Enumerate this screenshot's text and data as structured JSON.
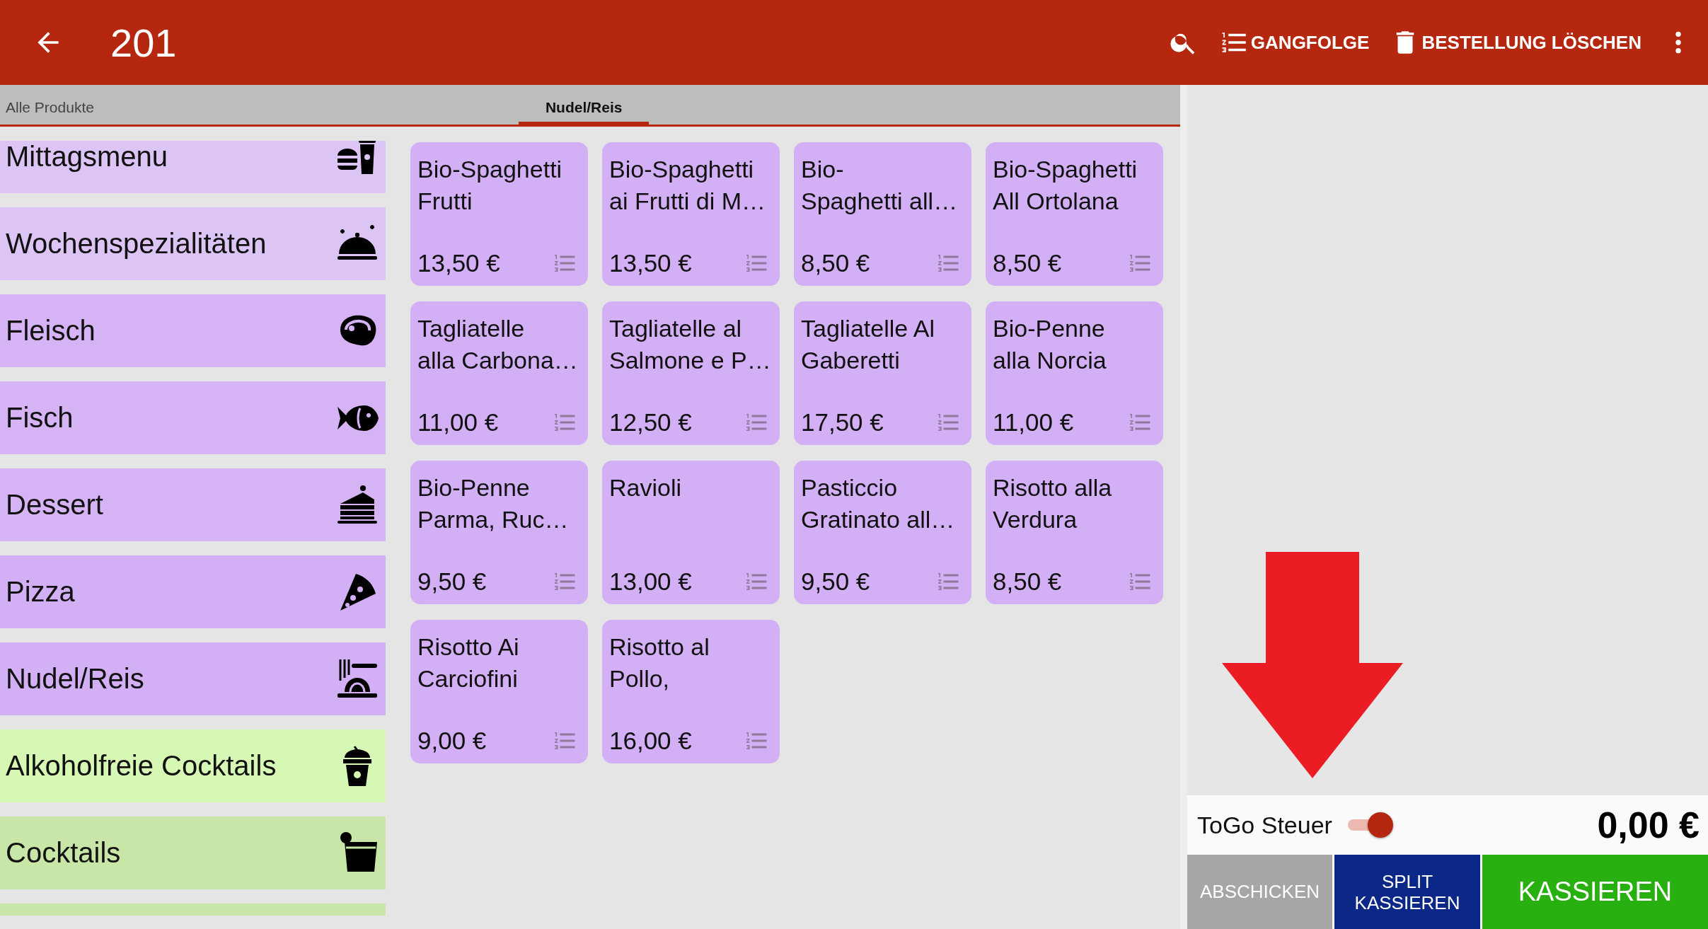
{
  "header": {
    "title": "201",
    "actions": [
      {
        "kind": "search"
      },
      {
        "kind": "order",
        "label": "GANGFOLGE"
      },
      {
        "kind": "delete",
        "label": "BESTELLUNG LÖSCHEN"
      },
      {
        "kind": "more"
      }
    ]
  },
  "tabs": [
    {
      "label": "Alle Produkte",
      "selected": false
    },
    {
      "label": "Nudel/Reis",
      "selected": true
    }
  ],
  "categories": [
    {
      "label": "Mittagsmenu",
      "color": "#dcc4f5"
    },
    {
      "label": "Wochenspezialitäten",
      "color": "#dcc4f5"
    },
    {
      "label": "Fleisch",
      "color": "#d5b3f5"
    },
    {
      "label": "Fisch",
      "color": "#d5b3f5"
    },
    {
      "label": "Dessert",
      "color": "#d5b3f5"
    },
    {
      "label": "Pizza",
      "color": "#d3b0f5"
    },
    {
      "label": "Nudel/Reis",
      "color": "#d3b0f5"
    },
    {
      "label": "Alkoholfreie Cocktails",
      "color": "#d6f8b4"
    },
    {
      "label": "Cocktails",
      "color": "#c8e6a8"
    },
    {
      "color": "#c8e6a8"
    }
  ],
  "products": [
    {
      "name": "Bio-Spaghetti\nFrutti",
      "price": "13,50 €"
    },
    {
      "name": "Bio-Spaghetti\nai Frutti di M…",
      "price": "13,50 €"
    },
    {
      "name": "Bio-\nSpaghetti all…",
      "price": "8,50 €"
    },
    {
      "name": "Bio-Spaghetti\nAll Ortolana",
      "price": "8,50 €"
    },
    {
      "name": "Tagliatelle\nalla Carbona…",
      "price": "11,00 €"
    },
    {
      "name": "Tagliatelle al\nSalmone e P…",
      "price": "12,50 €"
    },
    {
      "name": "Tagliatelle Al\nGaberetti",
      "price": "17,50 €"
    },
    {
      "name": "Bio-Penne\nalla Norcia",
      "price": "11,00 €"
    },
    {
      "name": "Bio-Penne\nParma, Ruc…",
      "price": "9,50 €"
    },
    {
      "name": "Ravioli",
      "price": "13,00 €"
    },
    {
      "name": "Pasticcio\nGratinato all…",
      "price": "9,50 €"
    },
    {
      "name": "Risotto alla\nVerdura",
      "price": "8,50 €"
    },
    {
      "name": "Risotto Ai\nCarciofini",
      "price": "9,00 €"
    },
    {
      "name": "Risotto al\nPollo,",
      "price": "16,00 €"
    }
  ],
  "togo": {
    "label": "ToGo Steuer",
    "on": true
  },
  "total": "0,00 €",
  "buttons": [
    {
      "kind": "send",
      "label": "ABSCHICKEN"
    },
    {
      "kind": "split",
      "label": "SPLIT\nKASSIEREN"
    },
    {
      "kind": "pay",
      "label": "KASSIEREN"
    }
  ]
}
